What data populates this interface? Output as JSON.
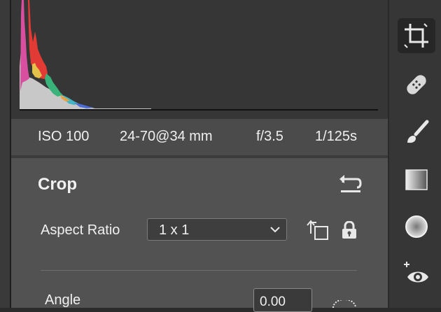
{
  "camera_info": {
    "iso": "ISO 100",
    "lens": "24-70@34 mm",
    "aperture": "f/3.5",
    "shutter": "1/125s"
  },
  "crop_panel": {
    "title": "Crop",
    "aspect_ratio_label": "Aspect Ratio",
    "aspect_ratio_value": "1 x 1",
    "angle_label": "Angle",
    "angle_value": "0.00"
  },
  "toolbar": {
    "tools": [
      "crop-icon",
      "healing-bandage-icon",
      "brush-icon",
      "gradient-filter-icon",
      "radial-filter-icon",
      "red-eye-icon"
    ],
    "active_tool": "crop-icon"
  },
  "colors": {
    "panel_bg": "#525252",
    "info_bar_bg": "#4b4b4b",
    "histogram_bg": "#363636",
    "toolbar_bg": "#363636"
  }
}
